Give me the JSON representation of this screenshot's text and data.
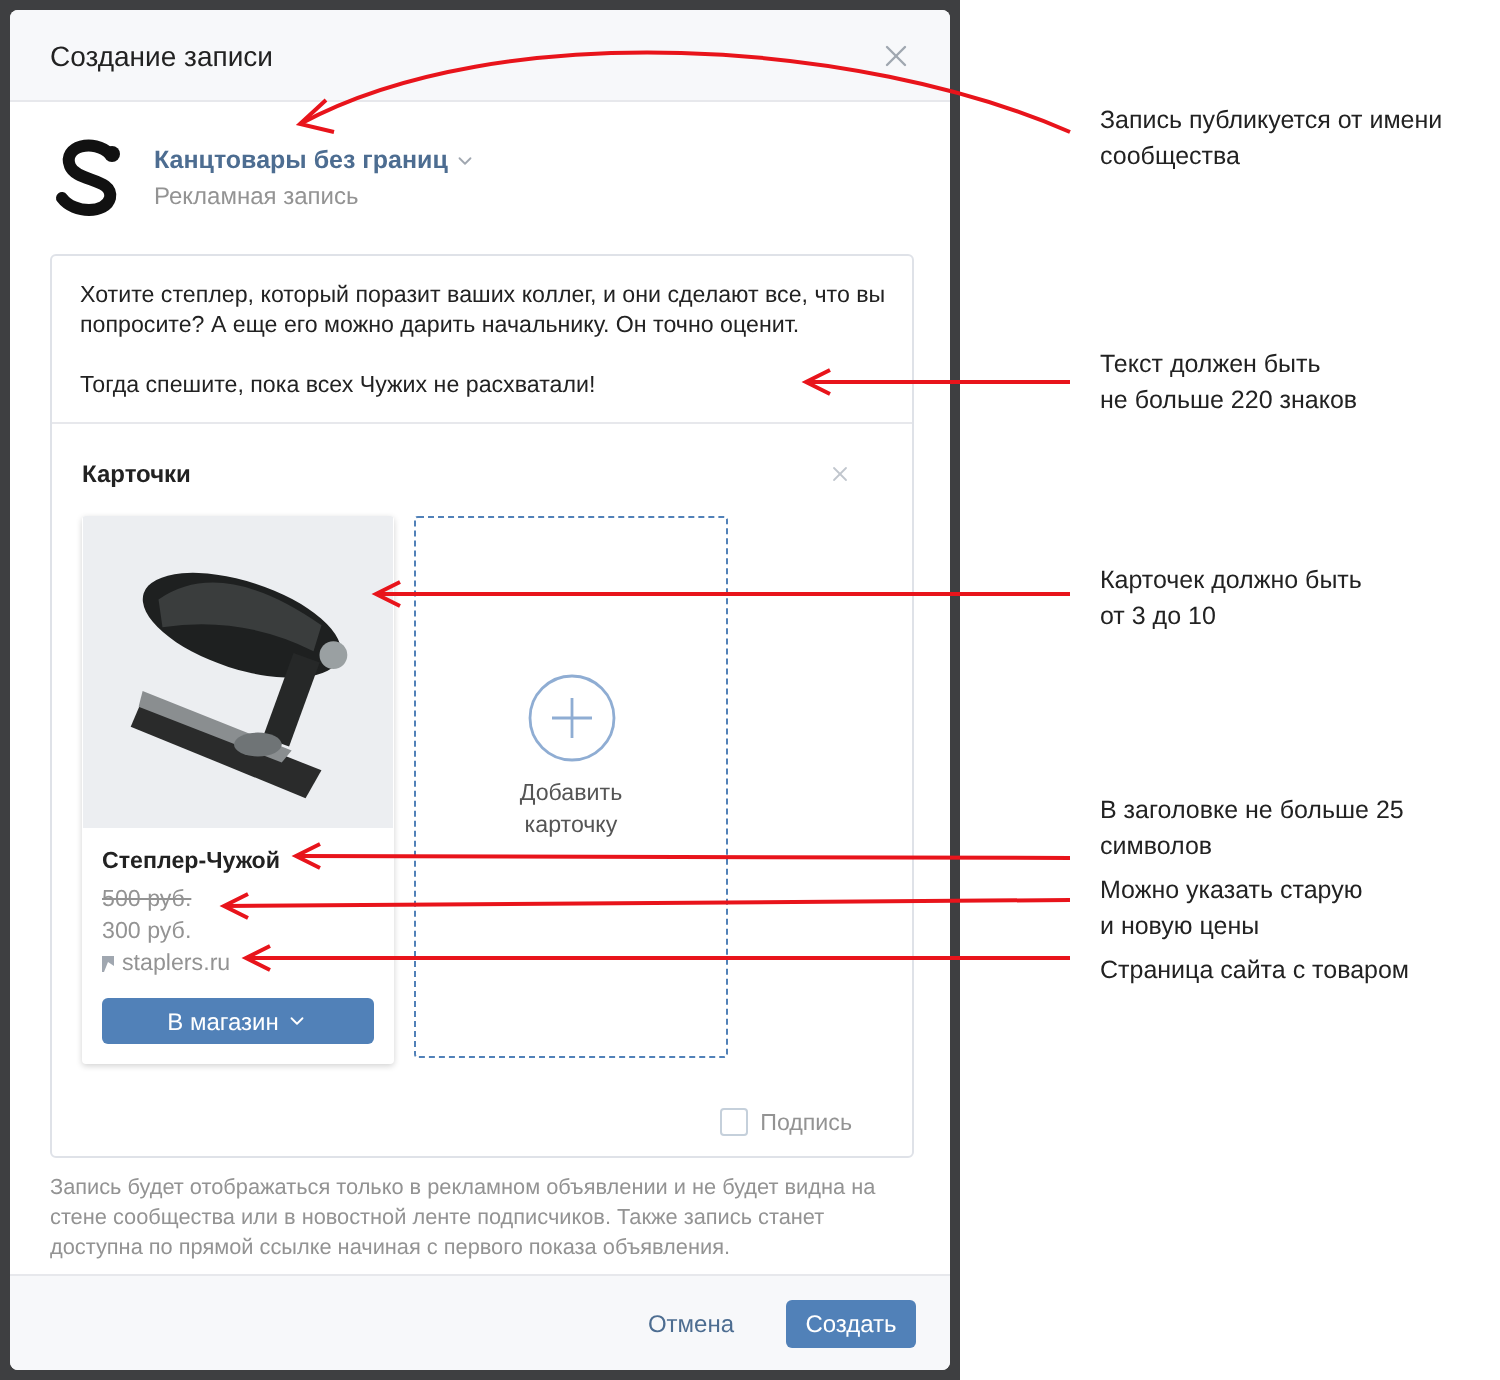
{
  "dialog": {
    "title": "Создание записи",
    "author": {
      "name": "Канцтовары без границ",
      "subtitle": "Рекламная запись"
    },
    "post_text": [
      "Хотите степлер, который поразит ваших коллег, и они сделают все, что вы попросите? А еще его можно дарить начальнику. Он точно оценит.",
      "Тогда спешите, пока всех Чужих не расхватали!"
    ],
    "cards_section": {
      "title": "Карточки",
      "cards": [
        {
          "kind": "product",
          "title": "Степлер-Чужой",
          "old_price": "500 руб.",
          "price": "300 руб.",
          "link": "staplers.ru",
          "button": "В магазин"
        },
        {
          "kind": "add",
          "label": "Добавить карточку"
        }
      ],
      "signature": {
        "label": "Подпись",
        "checked": false
      }
    },
    "note": "Запись будет отображаться только в рекламном объявлении и не будет видна на стене сообщества или в новостной ленте подписчиков. Также запись станет доступна по прямой ссылке начиная с первого показа объявления.",
    "buttons": {
      "cancel": "Отмена",
      "submit": "Создать"
    }
  },
  "annotations": [
    {
      "text": "Запись публикуется от имени\nсообщества"
    },
    {
      "text": "Текст должен быть\nне больше 220 знаков"
    },
    {
      "text": "Карточек должно быть\nот 3 до 10"
    },
    {
      "text": "В заголовке не больше 25\nсимволов"
    },
    {
      "text": "Можно указать старую\nи новую цены"
    },
    {
      "text": "Страница сайта с товаром"
    }
  ]
}
